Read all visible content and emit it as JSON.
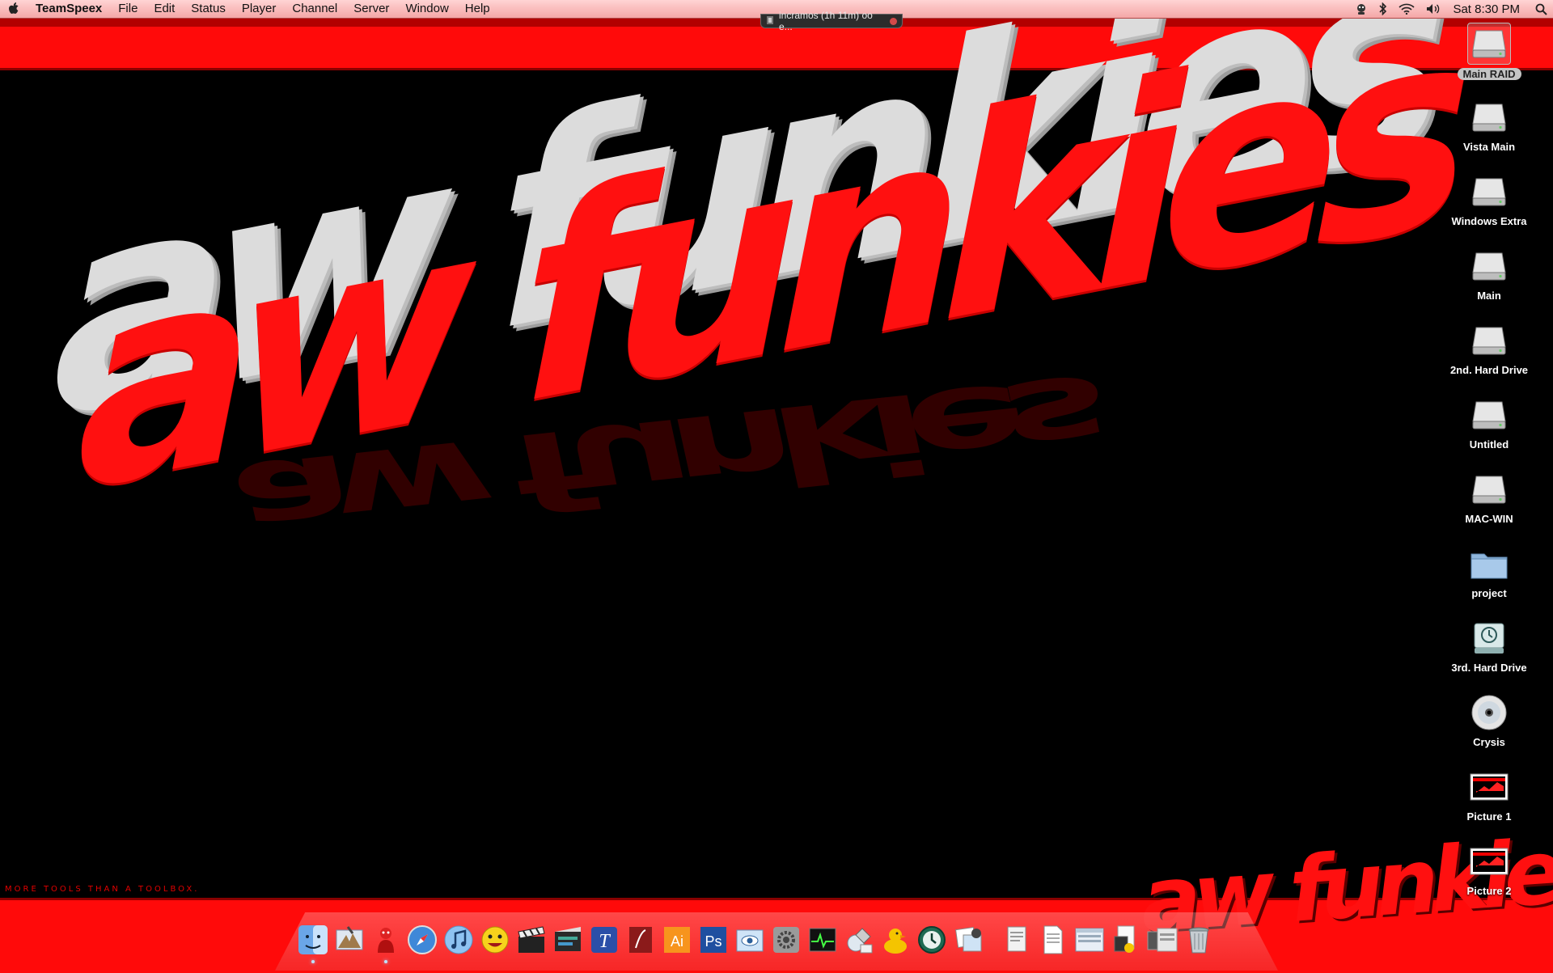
{
  "menubar": {
    "app_name": "TeamSpeex",
    "items": [
      "File",
      "Edit",
      "Status",
      "Player",
      "Channel",
      "Server",
      "Window",
      "Help"
    ],
    "clock": "Sat 8:30 PM"
  },
  "notification": {
    "text": "incramos (1h 11m) oo e..."
  },
  "wallpaper": {
    "logo_text": "aw funkies",
    "tagline": "MORE TOOLS THAN A TOOLBOX."
  },
  "desktop_icons": [
    {
      "label": "Main RAID",
      "icon": "hard-drive",
      "selected": true
    },
    {
      "label": "Vista Main",
      "icon": "hard-drive"
    },
    {
      "label": "Windows Extra",
      "icon": "hard-drive"
    },
    {
      "label": "Main",
      "icon": "hard-drive"
    },
    {
      "label": "2nd. Hard Drive",
      "icon": "hard-drive"
    },
    {
      "label": "Untitled",
      "icon": "hard-drive"
    },
    {
      "label": "MAC-WIN",
      "icon": "hard-drive"
    },
    {
      "label": "project",
      "icon": "folder"
    },
    {
      "label": "3rd. Hard Drive",
      "icon": "time-machine-drive"
    },
    {
      "label": "Crysis",
      "icon": "dvd-disc"
    },
    {
      "label": "Picture 1",
      "icon": "image-file"
    },
    {
      "label": "Picture 2",
      "icon": "image-file"
    }
  ],
  "dock": {
    "items": [
      {
        "name": "finder",
        "running": true
      },
      {
        "name": "mail"
      },
      {
        "name": "teamspeak",
        "running": true
      },
      {
        "name": "safari"
      },
      {
        "name": "itunes"
      },
      {
        "name": "messenger"
      },
      {
        "name": "clapper"
      },
      {
        "name": "final-cut"
      },
      {
        "name": "text-editor",
        "glyph": "T"
      },
      {
        "name": "illustrator-alt"
      },
      {
        "name": "illustrator",
        "glyph": "Ai"
      },
      {
        "name": "photoshop",
        "glyph": "Ps"
      },
      {
        "name": "preview"
      },
      {
        "name": "system-preferences"
      },
      {
        "name": "activity-monitor"
      },
      {
        "name": "network-utility"
      },
      {
        "name": "adium"
      },
      {
        "name": "time-machine"
      },
      {
        "name": "iphoto"
      },
      {
        "name": "document-stack"
      },
      {
        "name": "rtf-document"
      },
      {
        "name": "window-stack"
      },
      {
        "name": "folder-stack"
      },
      {
        "name": "trash"
      }
    ]
  },
  "colors": {
    "menubar": "#f4a6a6",
    "band_red": "#ff0a0a",
    "logo_red": "#ff1010",
    "background": "#000000"
  }
}
